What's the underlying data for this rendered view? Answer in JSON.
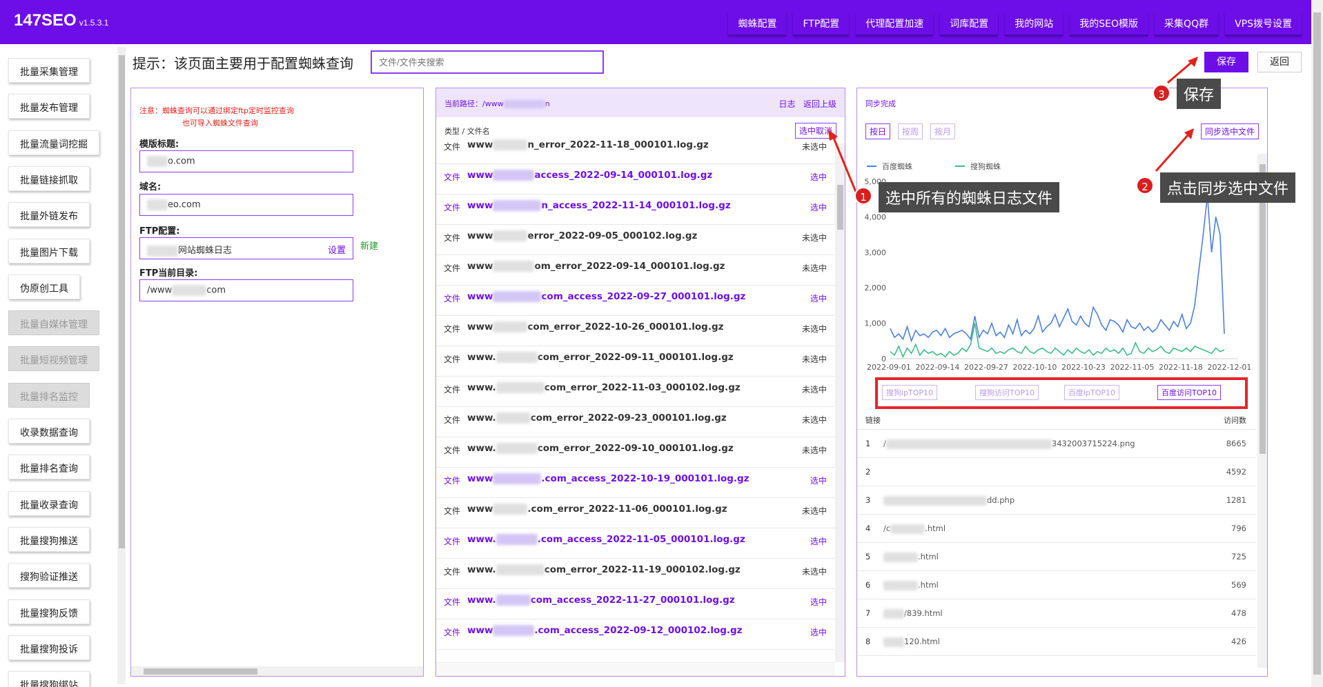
{
  "app": {
    "title": "147SEO",
    "version": "v1.5.3.1"
  },
  "nav": [
    "蜘蛛配置",
    "FTP配置",
    "代理配置加速",
    "词库配置",
    "我的网站",
    "我的SEO模版",
    "采集QQ群",
    "VPS拨号设置"
  ],
  "sidebar": [
    {
      "label": "批量采集管理",
      "disabled": false
    },
    {
      "label": "批量发布管理",
      "disabled": false
    },
    {
      "label": "批量流量词挖掘",
      "disabled": false
    },
    {
      "label": "批量链接抓取",
      "disabled": false
    },
    {
      "label": "批量外链发布",
      "disabled": false
    },
    {
      "label": "批量图片下载",
      "disabled": false
    },
    {
      "label": "伪原创工具",
      "disabled": false
    },
    {
      "label": "批量自媒体管理",
      "disabled": true
    },
    {
      "label": "批量短视频管理",
      "disabled": true
    },
    {
      "label": "批量排名监控",
      "disabled": true
    },
    {
      "label": "收录数据查询",
      "disabled": false
    },
    {
      "label": "批量排名查询",
      "disabled": false
    },
    {
      "label": "批量收录查询",
      "disabled": false
    },
    {
      "label": "批量搜狗推送",
      "disabled": false
    },
    {
      "label": "搜狗验证推送",
      "disabled": false
    },
    {
      "label": "批量搜狗反馈",
      "disabled": false
    },
    {
      "label": "批量搜狗投诉",
      "disabled": false
    },
    {
      "label": "批量搜狗绑站",
      "disabled": false
    }
  ],
  "header": {
    "hint": "提示：该页面主要用于配置蜘蛛查询",
    "search_placeholder": "文件/文件夹搜索",
    "save": "保存",
    "back": "返回"
  },
  "config": {
    "note_line1": "注意：蜘蛛查询可以通过绑定ftp定时监控查询",
    "note_line2": "也可导入蜘蛛文件查询",
    "template_label": "模版标题:",
    "template_value": "o.com",
    "domain_label": "域名:",
    "domain_value": "eo.com",
    "ftp_label": "FTP配置:",
    "ftp_value": "网站蜘蛛日志",
    "ftp_set": "设置",
    "ftp_new": "新建",
    "dir_label": "FTP当前目录:",
    "dir_prefix": "/www",
    "dir_suffix": "com"
  },
  "files": {
    "path_label": "当前路径：/www",
    "path_suffix": "n",
    "log_link": "日志",
    "up_link": "返回上级",
    "col_header": "类型 / 文件名",
    "toggle_btn": "选中取消",
    "type_label": "文件",
    "rows": [
      {
        "prefix": "www",
        "name": "n_error_2022-11-18_000101.log.gz",
        "state": "未选中",
        "selected": false
      },
      {
        "prefix": "www",
        "name": "access_2022-09-14_000101.log.gz",
        "state": "选中",
        "selected": true
      },
      {
        "prefix": "www",
        "name": "n_access_2022-11-14_000101.log.gz",
        "state": "选中",
        "selected": true
      },
      {
        "prefix": "www",
        "name": "error_2022-09-05_000102.log.gz",
        "state": "未选中",
        "selected": false
      },
      {
        "prefix": "www",
        "name": "om_error_2022-09-14_000101.log.gz",
        "state": "未选中",
        "selected": false
      },
      {
        "prefix": "www",
        "name": "com_access_2022-09-27_000101.log.gz",
        "state": "选中",
        "selected": true
      },
      {
        "prefix": "www",
        "name": "com_error_2022-10-26_000101.log.gz",
        "state": "未选中",
        "selected": false
      },
      {
        "prefix": "www.",
        "name": "com_error_2022-09-11_000101.log.gz",
        "state": "未选中",
        "selected": false
      },
      {
        "prefix": "www.",
        "name": "com_error_2022-11-03_000102.log.gz",
        "state": "未选中",
        "selected": false
      },
      {
        "prefix": "www.",
        "name": "com_error_2022-09-23_000101.log.gz",
        "state": "未选中",
        "selected": false
      },
      {
        "prefix": "www.",
        "name": "com_error_2022-09-10_000101.log.gz",
        "state": "未选中",
        "selected": false
      },
      {
        "prefix": "www",
        "name": ".com_access_2022-10-19_000101.log.gz",
        "state": "选中",
        "selected": true
      },
      {
        "prefix": "www",
        "name": ".com_error_2022-11-06_000101.log.gz",
        "state": "未选中",
        "selected": false
      },
      {
        "prefix": "www.",
        "name": ".com_access_2022-11-05_000101.log.gz",
        "state": "选中",
        "selected": true
      },
      {
        "prefix": "www.",
        "name": "com_error_2022-11-19_000102.log.gz",
        "state": "未选中",
        "selected": false
      },
      {
        "prefix": "www.",
        "name": "com_access_2022-11-27_000101.log.gz",
        "state": "选中",
        "selected": true
      },
      {
        "prefix": "www",
        "name": ".com_access_2022-09-12_000102.log.gz",
        "state": "选中",
        "selected": true
      }
    ]
  },
  "stats": {
    "status": "同步完成",
    "tabs": [
      "按日",
      "按周",
      "按月"
    ],
    "sync_btn": "同步选中文件",
    "top_buttons": [
      "搜狗ipTOP10",
      "搜狗访问TOP10",
      "百度ipTOP10",
      "百度访问TOP10"
    ],
    "col_link": "链接",
    "col_visits": "访问数",
    "rows": [
      {
        "idx": "1",
        "url_prefix": "/",
        "url_suffix": "3432003715224.png",
        "count": "8665"
      },
      {
        "idx": "2",
        "url_prefix": "",
        "url_suffix": "",
        "count": "4592"
      },
      {
        "idx": "3",
        "url_prefix": "",
        "url_suffix": "dd.php",
        "count": "1281"
      },
      {
        "idx": "4",
        "url_prefix": "/c",
        "url_suffix": ".html",
        "count": "796"
      },
      {
        "idx": "5",
        "url_prefix": "",
        "url_suffix": ".html",
        "count": "725"
      },
      {
        "idx": "6",
        "url_prefix": "",
        "url_suffix": ".html",
        "count": "569"
      },
      {
        "idx": "7",
        "url_prefix": "",
        "url_suffix": "/839.html",
        "count": "478"
      },
      {
        "idx": "8",
        "url_prefix": "",
        "url_suffix": "120.html",
        "count": "426"
      }
    ]
  },
  "chart_data": {
    "type": "line",
    "legend": [
      "百度蜘蛛",
      "搜狗蜘蛛"
    ],
    "ylim": [
      0,
      5000
    ],
    "yticks": [
      "0",
      "1,000",
      "2,000",
      "3,000",
      "4,000",
      "5,000"
    ],
    "xticks": [
      "2022-09-01",
      "2022-09-14",
      "2022-09-27",
      "2022-10-10",
      "2022-10-23",
      "2022-11-05",
      "2022-11-18",
      "2022-12-01"
    ],
    "series": [
      {
        "name": "百度蜘蛛",
        "color": "#4a7fe0",
        "values": [
          850,
          600,
          700,
          550,
          900,
          500,
          800,
          650,
          700,
          600,
          750,
          800,
          650,
          850,
          600,
          700,
          750,
          800,
          700,
          550,
          1200,
          600,
          800,
          700,
          1000,
          650,
          750,
          600,
          950,
          700,
          1100,
          650,
          800,
          700,
          850,
          1200,
          750,
          900,
          1000,
          1250,
          900,
          1150,
          1400,
          1050,
          950,
          1200,
          1000,
          900,
          1450,
          1250,
          950,
          800,
          1100,
          1050,
          950,
          750,
          1100,
          900,
          850,
          1000,
          800,
          900,
          750,
          850,
          1100,
          950,
          800,
          1050,
          900,
          1250,
          850,
          1000,
          1500,
          2500,
          3500,
          4600,
          3000,
          4000,
          3500,
          700
        ]
      },
      {
        "name": "搜狗蜘蛛",
        "color": "#3dbb8a",
        "values": [
          200,
          100,
          350,
          50,
          300,
          150,
          400,
          100,
          250,
          150,
          200,
          100,
          150,
          50,
          200,
          100,
          150,
          300,
          200,
          400,
          1000,
          300,
          250,
          200,
          300,
          150,
          200,
          150,
          250,
          300,
          200,
          150,
          350,
          200,
          150,
          250,
          300,
          200,
          150,
          300,
          200,
          100,
          250,
          150,
          300,
          200,
          150,
          250,
          100,
          200,
          150,
          300,
          200,
          250,
          150,
          300,
          100,
          150,
          450,
          200,
          150,
          300,
          200,
          250,
          350,
          200,
          150,
          300,
          250,
          200,
          300,
          200,
          350,
          300,
          250,
          200,
          150,
          300,
          200,
          250
        ]
      }
    ]
  },
  "annotations": {
    "step1": "选中所有的蜘蛛日志文件",
    "step2": "点击同步选中文件",
    "step3": "保存",
    "n1": "1",
    "n2": "2",
    "n3": "3"
  }
}
